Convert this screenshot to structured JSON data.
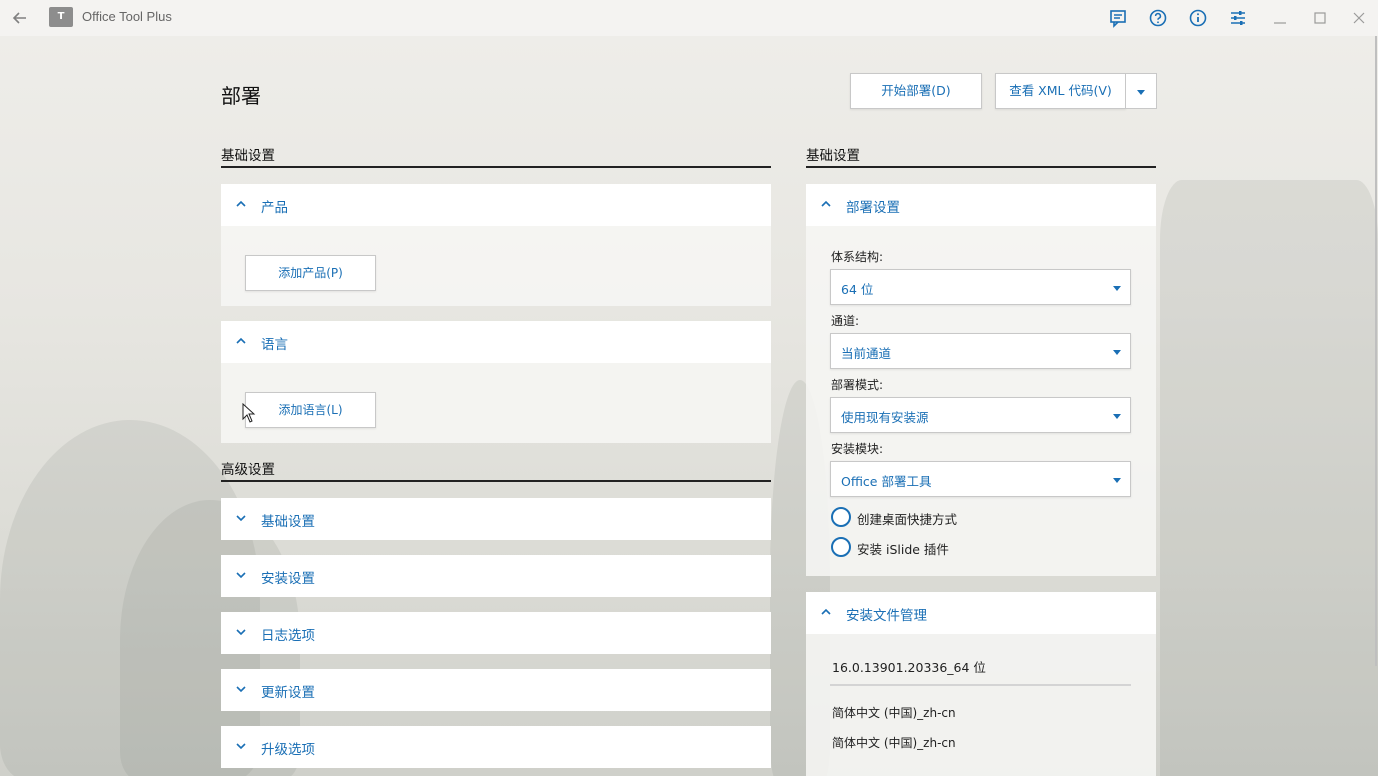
{
  "window": {
    "title": "Office Tool Plus",
    "logo_text": "T"
  },
  "page": {
    "title": "部署"
  },
  "actions": {
    "start_deploy": "开始部署(D)",
    "view_xml": "查看 XML 代码(V)"
  },
  "left": {
    "basic_heading": "基础设置",
    "product_panel": {
      "title": "产品",
      "button": "添加产品(P)"
    },
    "language_panel": {
      "title": "语言",
      "button": "添加语言(L)"
    },
    "advanced_heading": "高级设置",
    "advanced_panels": [
      {
        "title": "基础设置"
      },
      {
        "title": "安装设置"
      },
      {
        "title": "日志选项"
      },
      {
        "title": "更新设置"
      },
      {
        "title": "升级选项"
      }
    ]
  },
  "right": {
    "basic_heading": "基础设置",
    "deploy_panel": {
      "title": "部署设置",
      "architecture": {
        "label": "体系结构:",
        "value": "64 位"
      },
      "channel": {
        "label": "通道:",
        "value": "当前通道"
      },
      "mode": {
        "label": "部署模式:",
        "value": "使用现有安装源"
      },
      "module": {
        "label": "安装模块:",
        "value": "Office 部署工具"
      },
      "options": [
        {
          "label": "创建桌面快捷方式",
          "checked": false
        },
        {
          "label": "安装 iSlide 插件",
          "checked": false
        }
      ]
    },
    "files_panel": {
      "title": "安装文件管理",
      "version": "16.0.13901.20336_64 位",
      "languages": [
        "简体中文 (中国)_zh-cn",
        "简体中文 (中国)_zh-cn"
      ]
    }
  },
  "colors": {
    "accent": "#1a6fb5",
    "panel": "#ffffff"
  }
}
